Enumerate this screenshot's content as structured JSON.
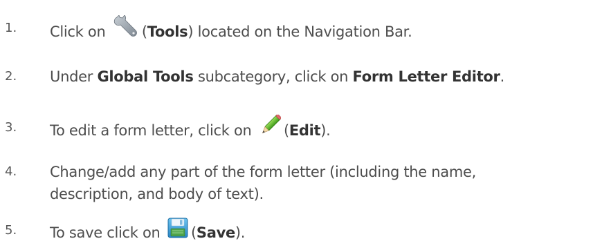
{
  "steps": [
    {
      "number": "1.",
      "before": "Click on",
      "icon": "wrench-icon",
      "bold": "Tools",
      "after": ") located on the Navigation Bar."
    },
    {
      "number": "2.",
      "before": "Under",
      "bold1": "Global Tools",
      "middle": "subcategory, click on",
      "bold2": "Form Letter Editor",
      "after": "."
    },
    {
      "number": "3.",
      "before": "To edit a form letter, click on",
      "icon": "pencil-icon",
      "bold": "Edit",
      "after": ")."
    },
    {
      "number": "4.",
      "line1": "Change/add any part of the form letter (including the name,",
      "line2": "description, and body of text)."
    },
    {
      "number": "5.",
      "before": "To save click on",
      "icon": "floppy-disk-icon",
      "bold": "Save",
      "after": ")."
    }
  ],
  "colors": {
    "text": "#4d4d4d",
    "wrench": "#8f99a3",
    "pencil_body": "#6cbf2e",
    "floppy": "#3fa0d8"
  }
}
